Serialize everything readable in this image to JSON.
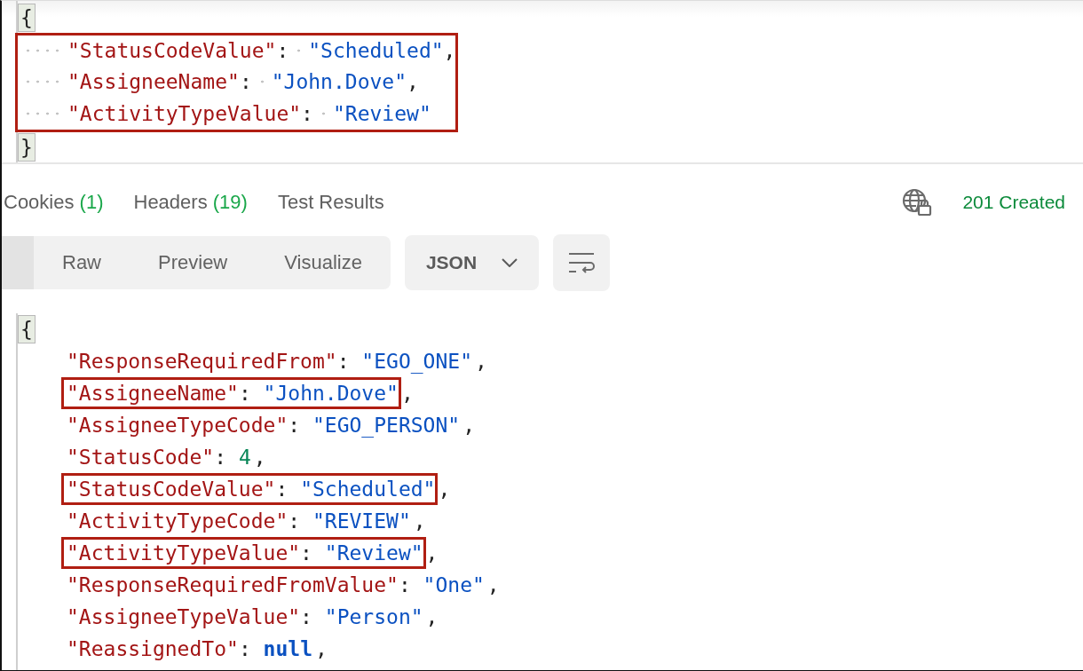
{
  "request_body": {
    "open": "{",
    "close": "}",
    "highlighted": true,
    "lines": [
      {
        "key": "\"StatusCodeValue\"",
        "colon": ":",
        "value": "\"Scheduled\"",
        "kind": "string",
        "comma": ","
      },
      {
        "key": "\"AssigneeName\"",
        "colon": ":",
        "value": "\"John.Dove\"",
        "kind": "string",
        "comma": ","
      },
      {
        "key": "\"ActivityTypeValue\"",
        "colon": ":",
        "value": "\"Review\"",
        "kind": "string"
      }
    ]
  },
  "response_tabs": [
    {
      "label": "Cookies",
      "count": "(1)"
    },
    {
      "label": "Headers",
      "count": "(19)"
    },
    {
      "label": "Test Results"
    }
  ],
  "status": "201 Created",
  "view_modes": [
    "Raw",
    "Preview",
    "Visualize"
  ],
  "format": "JSON",
  "response_body": {
    "open": "{",
    "lines": [
      {
        "key": "\"ResponseRequiredFrom\"",
        "colon": ":",
        "value": "\"EGO_ONE\"",
        "kind": "string",
        "comma": ",",
        "highlighted": false
      },
      {
        "key": "\"AssigneeName\"",
        "colon": ":",
        "value": "\"John.Dove\"",
        "kind": "string",
        "comma": ",",
        "highlighted": true
      },
      {
        "key": "\"AssigneeTypeCode\"",
        "colon": ":",
        "value": "\"EGO_PERSON\"",
        "kind": "string",
        "comma": ",",
        "highlighted": false
      },
      {
        "key": "\"StatusCode\"",
        "colon": ":",
        "value": "4",
        "kind": "number",
        "comma": ",",
        "highlighted": false
      },
      {
        "key": "\"StatusCodeValue\"",
        "colon": ":",
        "value": "\"Scheduled\"",
        "kind": "string",
        "comma": ",",
        "highlighted": true
      },
      {
        "key": "\"ActivityTypeCode\"",
        "colon": ":",
        "value": "\"REVIEW\"",
        "kind": "string",
        "comma": ",",
        "highlighted": false
      },
      {
        "key": "\"ActivityTypeValue\"",
        "colon": ":",
        "value": "\"Review\"",
        "kind": "string",
        "comma": ",",
        "highlighted": true
      },
      {
        "key": "\"ResponseRequiredFromValue\"",
        "colon": ":",
        "value": "\"One\"",
        "kind": "string",
        "comma": ",",
        "highlighted": false
      },
      {
        "key": "\"AssigneeTypeValue\"",
        "colon": ":",
        "value": "\"Person\"",
        "kind": "string",
        "comma": ",",
        "highlighted": false
      },
      {
        "key": "\"ReassignedTo\"",
        "colon": ":",
        "value": "null",
        "kind": "null",
        "comma": ",",
        "highlighted": false
      }
    ]
  }
}
